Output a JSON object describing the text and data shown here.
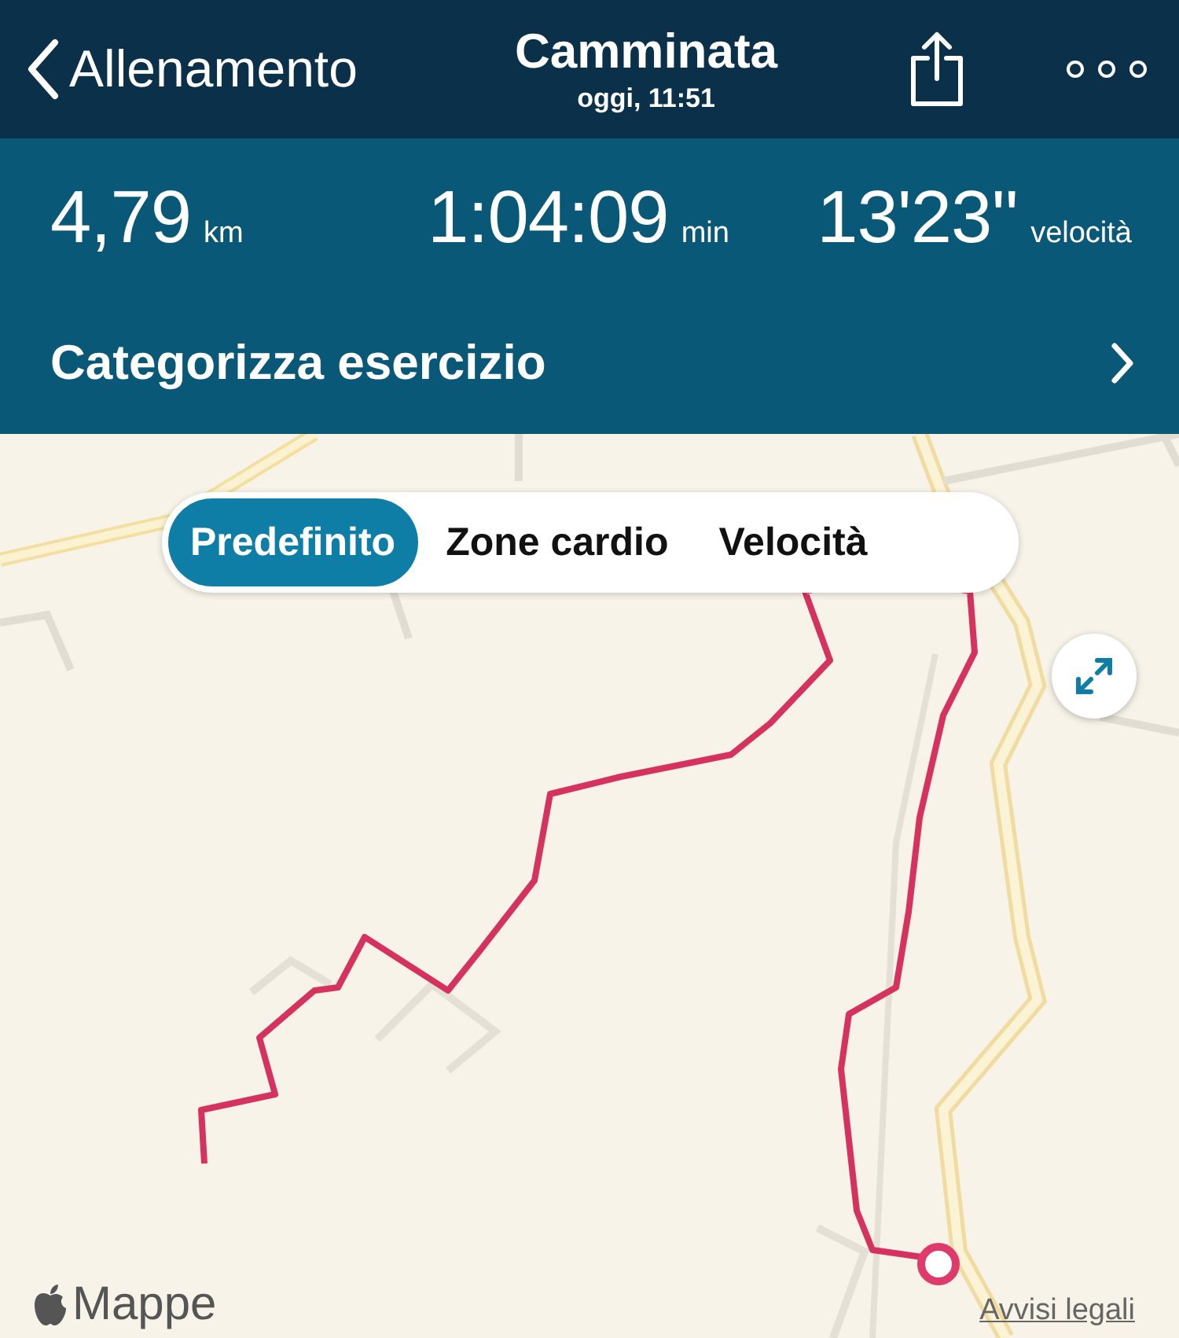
{
  "nav": {
    "back_label": "Allenamento",
    "title": "Camminata",
    "subtitle": "oggi, 11:51"
  },
  "stats": [
    {
      "value": "4,79",
      "unit": "km"
    },
    {
      "value": "1:04:09",
      "unit": "min"
    },
    {
      "value": "13'23''",
      "unit": "velocità"
    }
  ],
  "category_row": {
    "label": "Categorizza esercizio"
  },
  "map": {
    "kind": "picture",
    "segments": [
      {
        "label": "Predefinito",
        "selected": true
      },
      {
        "label": "Zone cardio",
        "selected": false
      },
      {
        "label": "Velocità",
        "selected": false
      }
    ],
    "attribution": "Mappe",
    "legal_link": "Avvisi legali"
  }
}
